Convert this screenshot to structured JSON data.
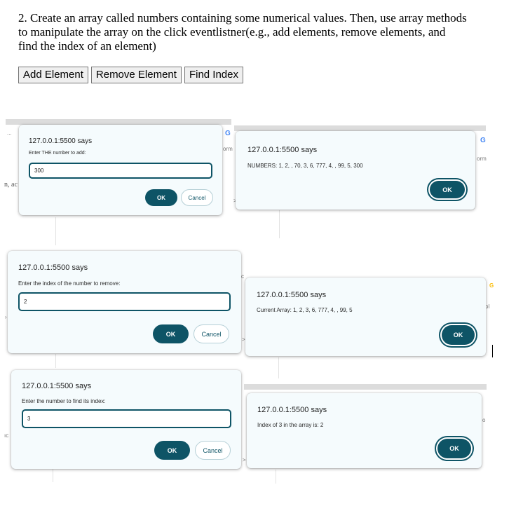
{
  "question": "2. Create an array called numbers containing some numerical values. Then, use array methods to manipulate the array on the click eventlistner(e.g., add elements, remove elements, and find the index of an element)",
  "buttons": {
    "add": "Add Element",
    "remove": "Remove Element",
    "find": "Find Index"
  },
  "bg_fragments": {
    "dots": "...",
    "nac": "n, ac",
    "orm1": "orm",
    "orm2": "orm",
    "arrow1": ">",
    "arrow2": ">",
    "arrow3": ">",
    "c": "c",
    "o": "o",
    "ic": "ıc",
    "chevron": "›",
    "ol": "ol"
  },
  "google_icon": "G",
  "colors": {
    "accent": "#0e5466",
    "dialog_bg": "#f5fbfd"
  },
  "dialogs": {
    "add_prompt": {
      "title": "127.0.0.1:5500 says",
      "message": "Enter THE number to add:",
      "value": "300",
      "ok": "OK",
      "cancel": "Cancel"
    },
    "add_alert": {
      "title": "127.0.0.1:5500 says",
      "message": "NUMBERS: 1, 2, , 70, 3, 6, 777, 4, , 99, 5, 300",
      "ok": "OK"
    },
    "remove_prompt": {
      "title": "127.0.0.1:5500 says",
      "message": "Enter the index of the number to remove:",
      "value": "2",
      "ok": "OK",
      "cancel": "Cancel"
    },
    "remove_alert": {
      "title": "127.0.0.1:5500 says",
      "message": "Current Array: 1, 2, 3, 6, 777, 4, , 99, 5",
      "ok": "OK"
    },
    "find_prompt": {
      "title": "127.0.0.1:5500 says",
      "message": "Enter the number to find its index:",
      "value": "3",
      "ok": "OK",
      "cancel": "Cancel"
    },
    "find_alert": {
      "title": "127.0.0.1:5500 says",
      "message": "Index of 3 in the array is: 2",
      "ok": "OK"
    }
  }
}
